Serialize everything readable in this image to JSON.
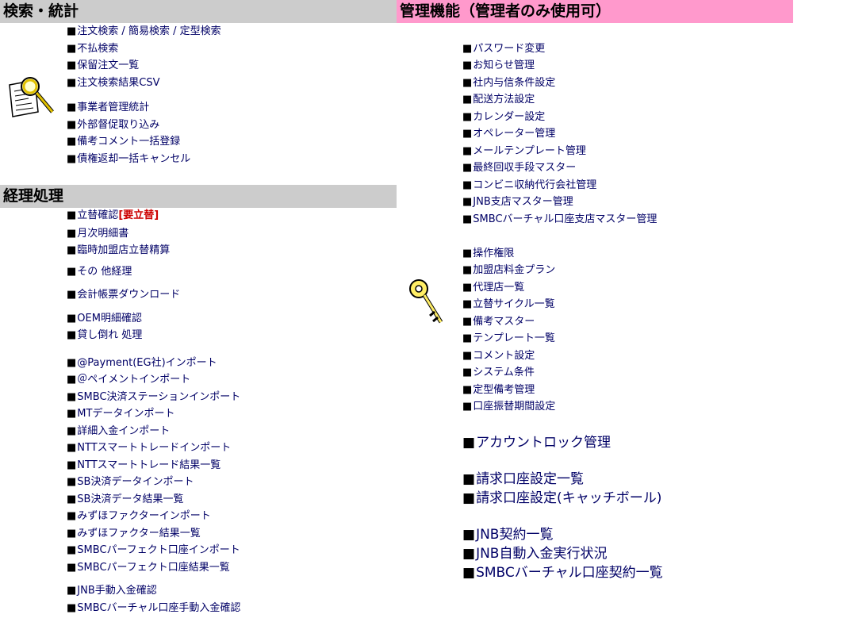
{
  "bullet": "■",
  "search": {
    "title": "検索・統計",
    "links": [
      "注文検索 / 簡易検索 / 定型検索",
      "不払検索",
      "保留注文一覧",
      "注文検索結果CSV",
      "事業者管理統計",
      "外部督促取り込み",
      "備考コメント一括登録",
      "債権返却一括キャンセル"
    ]
  },
  "accounting": {
    "title": "経理処理",
    "first_label": "立替確認",
    "first_badge": "[要立替]",
    "links": [
      "月次明細書",
      "臨時加盟店立替精算",
      "その 他経理",
      "会計帳票ダウンロード",
      "OEM明細確認",
      "貸し倒れ 処理",
      "@Payment(EG社)インポート",
      "＠ペイメントインポート",
      "SMBC決済ステーションインポート",
      "MTデータインポート",
      "詳細入金インポート",
      "NTTスマートトレードインポート",
      "NTTスマートトレード結果一覧",
      "SB決済データインポート",
      "SB決済データ結果一覧",
      "みずほファクターインポート",
      "みずほファクター結果一覧",
      "SMBCパーフェクト口座インポート",
      "SMBCパーフェクト口座結果一覧",
      "JNB手動入金確認",
      "SMBCバーチャル口座手動入金確認"
    ]
  },
  "admin": {
    "title": "管理機能（管理者のみ使用可）",
    "links": [
      "パスワード変更",
      "お知らせ管理",
      "社内与信条件設定",
      "配送方法設定",
      "カレンダー設定",
      "オペレーター管理",
      "メールテンプレート管理",
      "最終回収手段マスター",
      "コンビニ収納代行会社管理",
      "JNB支店マスター管理",
      "SMBCバーチャル口座支店マスター管理",
      "操作権限",
      "加盟店料金プラン",
      "代理店一覧",
      "立替サイクル一覧",
      "備考マスター",
      "テンプレート一覧",
      "コメント設定",
      "システム条件",
      "定型備考管理",
      "口座振替期間設定"
    ],
    "big_links": [
      "アカウントロック管理",
      "請求口座設定一覧",
      "請求口座設定(キャッチボール)",
      "JNB契約一覧",
      "JNB自動入金実行状況",
      "SMBCバーチャル口座契約一覧"
    ]
  },
  "icons": {
    "search": "magnifier-document-icon",
    "admin": "key-icon"
  },
  "colors": {
    "gray_header": "#cccccc",
    "pink_header": "#ff99cc",
    "link": "#000066",
    "warning": "#cc0000"
  }
}
